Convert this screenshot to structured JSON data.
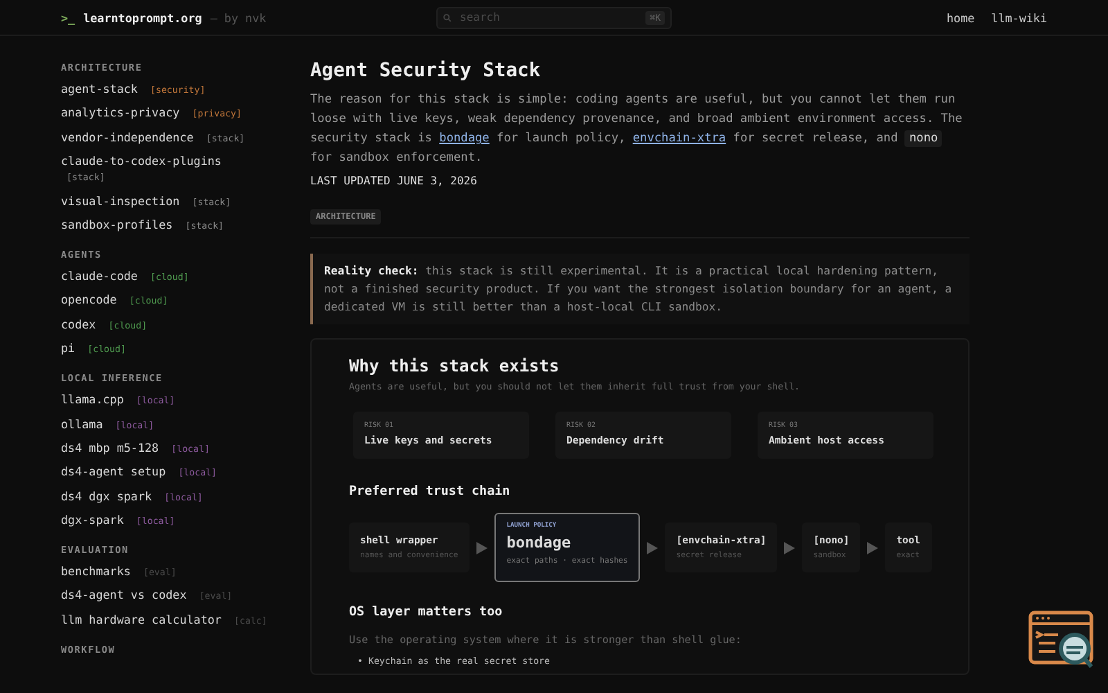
{
  "header": {
    "prompt": ">_",
    "site": "learntoprompt.org",
    "byline": "— by nvk",
    "search": {
      "placeholder": "search",
      "shortcut": "⌘K"
    },
    "nav": [
      "home",
      "llm-wiki"
    ]
  },
  "sidebar": {
    "sections": [
      {
        "title": "ARCHITECTURE",
        "items": [
          {
            "label": "agent-stack",
            "tag": "[security]",
            "color": "#c0763a"
          },
          {
            "label": "analytics-privacy",
            "tag": "[privacy]",
            "color": "#c0763a"
          },
          {
            "label": "vendor-independence",
            "tag": "[stack]",
            "color": "#8a8a8a"
          },
          {
            "label": "claude-to-codex-plugins",
            "tag": "[stack]",
            "color": "#8a8a8a"
          },
          {
            "label": "visual-inspection",
            "tag": "[stack]",
            "color": "#8a8a8a"
          },
          {
            "label": "sandbox-profiles",
            "tag": "[stack]",
            "color": "#8a8a8a"
          }
        ]
      },
      {
        "title": "AGENTS",
        "items": [
          {
            "label": "claude-code",
            "tag": "[cloud]",
            "color": "#4f9a4f"
          },
          {
            "label": "opencode",
            "tag": "[cloud]",
            "color": "#4f9a4f"
          },
          {
            "label": "codex",
            "tag": "[cloud]",
            "color": "#4f9a4f"
          },
          {
            "label": "pi",
            "tag": "[cloud]",
            "color": "#4f9a4f"
          }
        ]
      },
      {
        "title": "LOCAL INFERENCE",
        "items": [
          {
            "label": "llama.cpp",
            "tag": "[local]",
            "color": "#8d5a9e"
          },
          {
            "label": "ollama",
            "tag": "[local]",
            "color": "#8d5a9e"
          },
          {
            "label": "ds4 mbp m5-128",
            "tag": "[local]",
            "color": "#8d5a9e"
          },
          {
            "label": "ds4-agent setup",
            "tag": "[local]",
            "color": "#8d5a9e"
          },
          {
            "label": "ds4 dgx spark",
            "tag": "[local]",
            "color": "#8d5a9e"
          },
          {
            "label": "dgx-spark",
            "tag": "[local]",
            "color": "#8d5a9e"
          }
        ]
      },
      {
        "title": "EVALUATION",
        "items": [
          {
            "label": "benchmarks",
            "tag": "[eval]",
            "color": "#4a4a4a"
          },
          {
            "label": "ds4-agent vs codex",
            "tag": "[eval]",
            "color": "#4a4a4a"
          },
          {
            "label": "llm hardware calculator",
            "tag": "[calc]",
            "color": "#4a4a4a"
          }
        ]
      },
      {
        "title": "WORKFLOW"
      }
    ]
  },
  "article": {
    "title": "Agent Security Stack",
    "intro": [
      {
        "kind": "text",
        "text": "The reason for this stack is simple: coding agents are useful, but you cannot let them run loose with live keys, weak dependency provenance, and broad ambient environment access. The security stack is "
      },
      {
        "kind": "link",
        "text": "bondage"
      },
      {
        "kind": "text",
        "text": " for launch policy, "
      },
      {
        "kind": "link",
        "text": "envchain-xtra"
      },
      {
        "kind": "text",
        "text": " for secret release, and "
      },
      {
        "kind": "code",
        "text": "nono"
      },
      {
        "kind": "text",
        "text": " for sandbox enforcement."
      }
    ],
    "updated": "LAST UPDATED JUNE 3, 2026",
    "tag": "ARCHITECTURE",
    "callout": "**Reality check:** this stack is still experimental. It is a practical local hardening pattern, not a finished security product. If you want the strongest isolation boundary for an agent, a dedicated VM is still better than a host-local CLI sandbox.",
    "panel": {
      "heading": "Why this stack exists",
      "subtitle": "Agents are useful, but you should not let them inherit full trust from your shell.",
      "risks": [
        {
          "label": "RISK 01",
          "title": "Live keys and secrets"
        },
        {
          "label": "RISK 02",
          "title": "Dependency drift"
        },
        {
          "label": "RISK 03",
          "title": "Ambient host access"
        }
      ],
      "chain_heading": "Preferred trust chain",
      "chain": [
        {
          "kind": "step",
          "title": "shell wrapper",
          "note": "names and convenience"
        },
        {
          "kind": "featured",
          "eyebrow": "LAUNCH POLICY",
          "title": "bondage",
          "note": "exact paths · exact hashes"
        },
        {
          "kind": "step",
          "title": "[envchain-xtra]",
          "note": "secret release"
        },
        {
          "kind": "step",
          "title": "[nono]",
          "note": "sandbox"
        },
        {
          "kind": "step",
          "title": "tool",
          "note": "exact"
        }
      ],
      "os_heading": "OS layer matters too",
      "os_intro": "Use the operating system where it is stronger than shell glue:",
      "bullets": [
        {
          "marker": "•",
          "text": "Keychain as the real secret store"
        }
      ]
    }
  }
}
